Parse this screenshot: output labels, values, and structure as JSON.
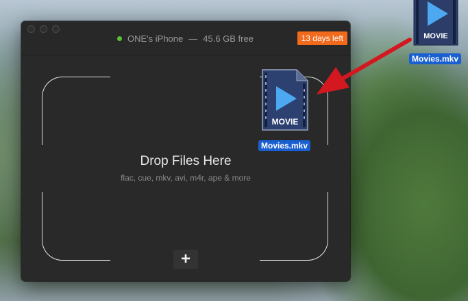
{
  "window": {
    "device_name": "ONE's iPhone",
    "separator": "—",
    "free_space": "45.6 GB free",
    "trial_badge": "13 days left"
  },
  "drop_zone": {
    "title": "Drop Files Here",
    "formats": "flac, cue, mkv, avi, m4r, ape & more"
  },
  "add_button": {
    "label": "+"
  },
  "file": {
    "name": "Movies.mkv",
    "icon_text": "MOVIE"
  },
  "colors": {
    "status_dot": "#5bc236",
    "trial_badge": "#f26a1b",
    "arrow": "#d3181f",
    "selection": "#1a5fd0"
  }
}
